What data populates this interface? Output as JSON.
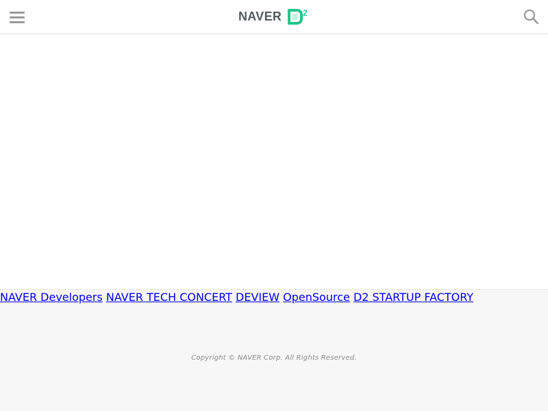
{
  "header": {
    "menu_icon": "hamburger-menu-icon",
    "logo_text": "NAVER",
    "logo_mark_text": "D2",
    "logo_colors": {
      "text": "#555a5e",
      "mark": "#1ec78a"
    },
    "search_icon": "search-icon"
  },
  "footer": {
    "links": [
      {
        "label": "NAVER Developers"
      },
      {
        "label": "NAVER TECH CONCERT"
      },
      {
        "label": "DEVIEW"
      },
      {
        "label": "OpenSource"
      },
      {
        "label": "D2 STARTUP FACTORY"
      }
    ],
    "copyright": "Copyright © NAVER Corp. All Rights Reserved.",
    "link_color": "#1a1ad2"
  }
}
